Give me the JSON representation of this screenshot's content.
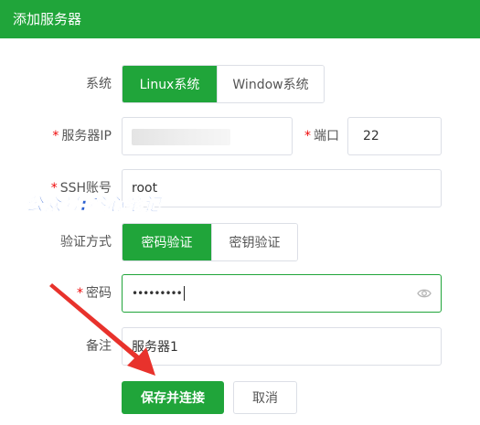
{
  "dialog": {
    "title": "添加服务器"
  },
  "form": {
    "system": {
      "label": "系统",
      "options": [
        "Linux系统",
        "Window系统"
      ],
      "selected": "Linux系统"
    },
    "server_ip": {
      "label": "服务器IP",
      "required_mark": "*",
      "value": ""
    },
    "port": {
      "label": "端口",
      "required_mark": "*",
      "value": "22"
    },
    "ssh_account": {
      "label": "SSH账号",
      "required_mark": "*",
      "value": "root"
    },
    "auth_method": {
      "label": "验证方式",
      "options": [
        "密码验证",
        "密钥验证"
      ],
      "selected": "密码验证"
    },
    "password": {
      "label": "密码",
      "required_mark": "*",
      "value": "•••••••••",
      "icon": "eye-icon"
    },
    "remark": {
      "label": "备注",
      "value": "服务器1"
    }
  },
  "buttons": {
    "save_connect": "保存并连接",
    "cancel": "取消"
  },
  "watermark": {
    "text": "公众号:叁心笔记"
  },
  "colors": {
    "accent": "#20a53a",
    "required": "#ef0808",
    "arrow": "#e8322c",
    "watermark": "#2a5fd0"
  }
}
